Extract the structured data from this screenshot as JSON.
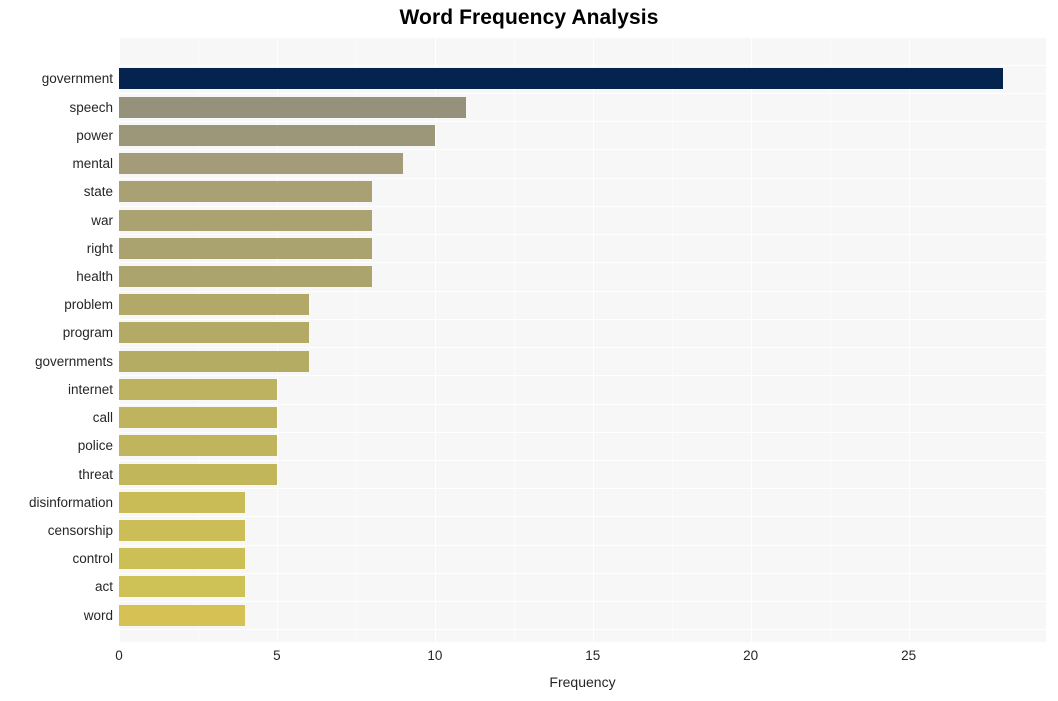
{
  "chart_data": {
    "type": "bar",
    "orientation": "horizontal",
    "title": "Word Frequency Analysis",
    "xlabel": "Frequency",
    "ylabel": "",
    "categories": [
      "government",
      "speech",
      "power",
      "mental",
      "state",
      "war",
      "right",
      "health",
      "problem",
      "program",
      "governments",
      "internet",
      "call",
      "police",
      "threat",
      "disinformation",
      "censorship",
      "control",
      "act",
      "word"
    ],
    "values": [
      28,
      11,
      10,
      9,
      8,
      8,
      8,
      8,
      6,
      6,
      6,
      5,
      5,
      5,
      5,
      4,
      4,
      4,
      4,
      4
    ],
    "bar_colors": [
      "#04234f",
      "#95917a",
      "#9d977a",
      "#a49c78",
      "#a9a173",
      "#aaa271",
      "#aba36f",
      "#aca46d",
      "#b2a968",
      "#b3aa66",
      "#b5ac64",
      "#bdb25f",
      "#bfb35e",
      "#c0b45d",
      "#c2b65b",
      "#c9bc57",
      "#cbbe56",
      "#ccbf55",
      "#cec155",
      "#d6c254"
    ],
    "xticks": [
      0,
      5,
      10,
      15,
      20,
      25
    ],
    "xlim": [
      0,
      29.35
    ],
    "grid": true,
    "legend": "none",
    "panel_background": "#f7f7f7",
    "gridline_color": "#ffffff",
    "title_color": "#000000",
    "tick_label_color": "#262626"
  }
}
